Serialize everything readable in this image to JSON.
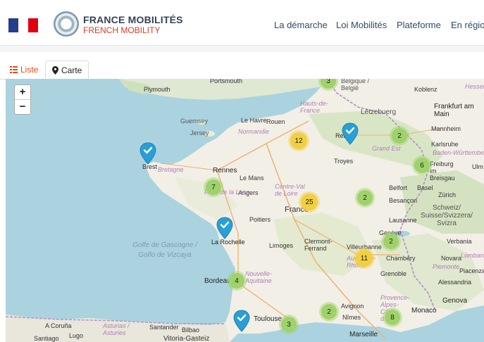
{
  "header": {
    "brand_title": "FRANCE MOBILITÉS",
    "brand_subtitle": "FRENCH MOBILITY",
    "nav": [
      "La démarche",
      "Loi Mobilités",
      "Plateforme",
      "En région"
    ]
  },
  "tabs": {
    "liste": "Liste",
    "carte": "Carte"
  },
  "map": {
    "zoom_in": "+",
    "zoom_out": "−",
    "clusters": [
      {
        "label": "3",
        "color": "green"
      },
      {
        "label": "12",
        "color": "yellow"
      },
      {
        "label": "2",
        "color": "green"
      },
      {
        "label": "6",
        "color": "green"
      },
      {
        "label": "7",
        "color": "green"
      },
      {
        "label": "25",
        "color": "yellow"
      },
      {
        "label": "2",
        "color": "green"
      },
      {
        "label": "2",
        "color": "green"
      },
      {
        "label": "11",
        "color": "yellow"
      },
      {
        "label": "4",
        "color": "green"
      },
      {
        "label": "2",
        "color": "green"
      },
      {
        "label": "3",
        "color": "green"
      },
      {
        "label": "8",
        "color": "green"
      }
    ],
    "cities": {
      "plymouth": "Plymouth",
      "portsmouth": "Portsmouth",
      "guernsey": "Guernsey",
      "jersey": "Jersey",
      "brest": "Brest",
      "bretagne": "Bretagne",
      "rennes": "Rennes",
      "le_havre": "Le Havre",
      "rouen": "Rouen",
      "normandie": "Normandie",
      "le_mans": "Le Mans",
      "angers": "Angers",
      "pays_loire": "Pays de la Loire",
      "centre_val": "Centre-Val de Loire",
      "france": "France",
      "poitiers": "Poitiers",
      "la_rochelle": "La Rochelle",
      "limoges": "Limoges",
      "clermont": "Clermont-Ferrand",
      "bordeaux": "Bordeaux",
      "nouvelle_aquitaine": "Nouvelle-Aquitaine",
      "toulouse": "Toulouse",
      "lille_region": "Hauts-de-France",
      "belgique": "Belgique / België",
      "letzebuerg": "Lëtzebuerg",
      "reims": "Reims",
      "troyes": "Troyes",
      "grand_est": "Grand Est",
      "koblenz": "Koblenz",
      "hessen": "Hessen",
      "frankfurt": "Frankfurt am Main",
      "mannheim": "Mannheim",
      "karlsruhe": "Karlsruhe",
      "bw": "Baden-Württemberg",
      "freiburg": "Freiburg im Breisgau",
      "ulm": "Ulm",
      "belfort": "Belfort",
      "basel": "Basel",
      "zurich": "Zürich",
      "besancon": "Besançon",
      "schweiz": "Schweiz/ Suisse/Svizzera/ Svizra",
      "lausanne": "Lausanne",
      "geneve": "Genève",
      "lyon": "Villeurbanne",
      "auvergne": "Auvergne-Rhône",
      "chambery": "Chambéry",
      "grenoble": "Grenoble",
      "verbania": "Verbania",
      "novara": "Novara",
      "lombardia": "Lombardia",
      "piemonte": "Piemonte",
      "piacenza": "Piacenza",
      "alessandria": "Alessandria",
      "genova": "Genova",
      "avignon": "Avignon",
      "provence": "Provence-Alpes-Côte d'Azur",
      "monaco": "Monaco",
      "nimes": "Nîmes",
      "marseille": "Marseille",
      "coruna": "A Coruña",
      "lugo": "Lugo",
      "santiago": "Santiago",
      "asturias": "Asturias / Asturies",
      "santander": "Santander",
      "bilbao": "Bilbao",
      "vitoria": "Vitoria-Gasteiz",
      "golfe": "Golfe de Gascogne / Golfo de Vizcaya"
    }
  }
}
